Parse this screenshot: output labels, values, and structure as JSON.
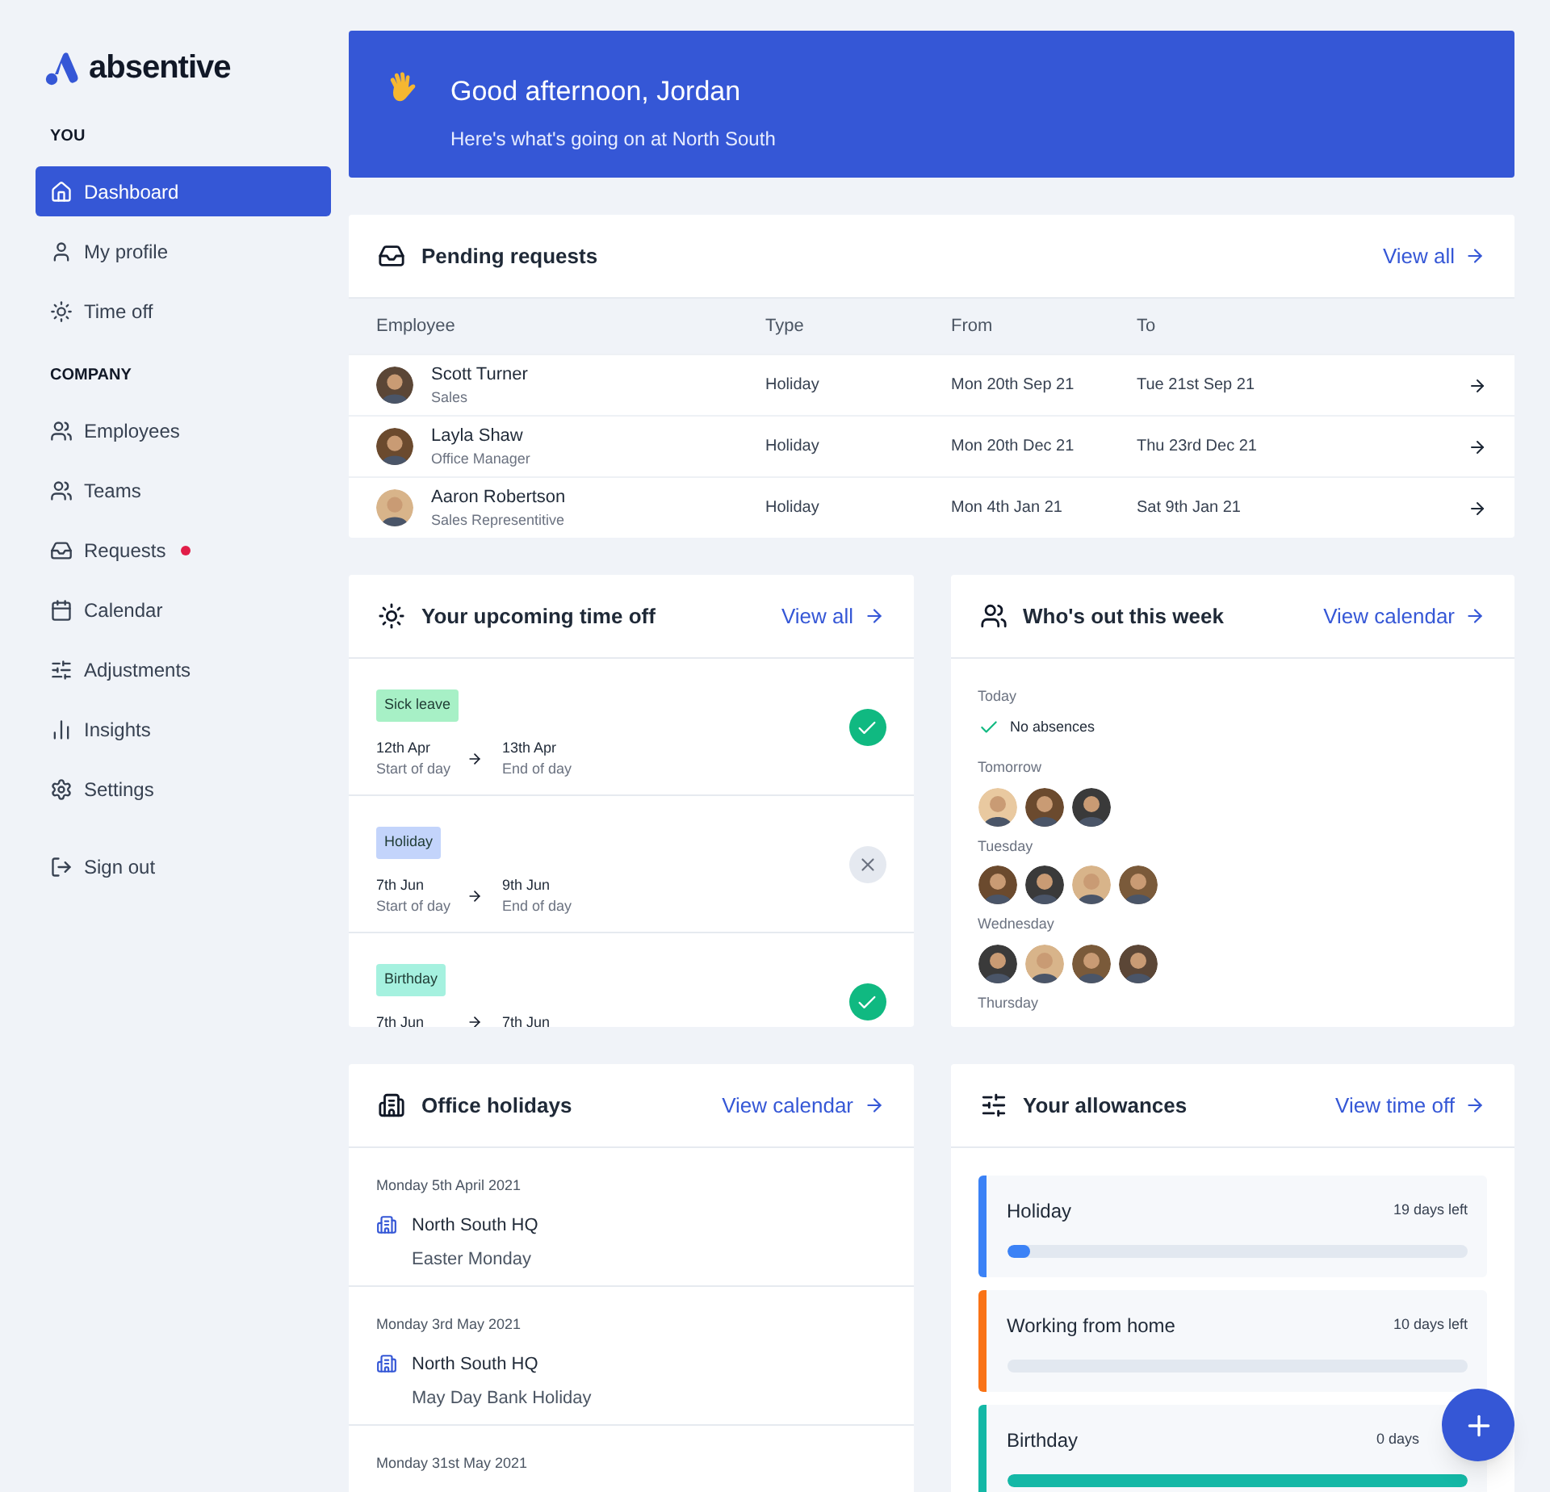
{
  "brand": {
    "name": "absentive"
  },
  "sidebar": {
    "sections": [
      {
        "title": "YOU",
        "items": [
          {
            "label": "Dashboard",
            "selected": true,
            "dot": false
          },
          {
            "label": "My profile",
            "selected": false,
            "dot": false
          },
          {
            "label": "Time off",
            "selected": false,
            "dot": false
          }
        ]
      },
      {
        "title": "COMPANY",
        "items": [
          {
            "label": "Employees",
            "selected": false,
            "dot": false
          },
          {
            "label": "Teams",
            "selected": false,
            "dot": false
          },
          {
            "label": "Requests",
            "selected": false,
            "dot": true
          },
          {
            "label": "Calendar",
            "selected": false,
            "dot": false
          },
          {
            "label": "Adjustments",
            "selected": false,
            "dot": false
          },
          {
            "label": "Insights",
            "selected": false,
            "dot": false
          },
          {
            "label": "Settings",
            "selected": false,
            "dot": false
          }
        ]
      }
    ],
    "sign_out": "Sign out"
  },
  "welcome": {
    "title": "Good afternoon, Jordan",
    "subtitle": "Here's what's going on at North South"
  },
  "pending_requests": {
    "title": "Pending requests",
    "link": "View all",
    "columns": [
      "Employee",
      "Type",
      "From",
      "To"
    ],
    "rows": [
      {
        "name": "Scott Turner",
        "role": "Sales",
        "type": "Holiday",
        "from": "Mon 20th Sep 21",
        "to": "Tue 21st Sep 21"
      },
      {
        "name": "Layla Shaw",
        "role": "Office Manager",
        "type": "Holiday",
        "from": "Mon 20th Dec 21",
        "to": "Thu 23rd Dec 21"
      },
      {
        "name": "Aaron Robertson",
        "role": "Sales Representitive",
        "type": "Holiday",
        "from": "Mon 4th Jan 21",
        "to": "Sat 9th Jan 21"
      }
    ]
  },
  "upcoming_time_off": {
    "title": "Your upcoming time off",
    "link": "View all",
    "items": [
      {
        "tag": "Sick leave",
        "color": "#a7f0c6",
        "approved": true,
        "start": "12th Apr",
        "start_note": "Start of day",
        "end": "13th Apr",
        "end_note": "End of day"
      },
      {
        "tag": "Holiday",
        "color": "#c3d4fb",
        "approved": false,
        "start": "7th Jun",
        "start_note": "Start of day",
        "end": "9th Jun",
        "end_note": "End of day"
      },
      {
        "tag": "Birthday",
        "color": "#a5f1df",
        "approved": true,
        "start": "7th Jun",
        "end": "7th Jun"
      }
    ]
  },
  "whos_out": {
    "title": "Who's out this week",
    "link": "View calendar",
    "days": [
      {
        "label": "Today",
        "none_text": "No absences"
      },
      {
        "label": "Tomorrow"
      },
      {
        "label": "Tuesday"
      },
      {
        "label": "Wednesday"
      },
      {
        "label": "Thursday"
      }
    ]
  },
  "office_holidays": {
    "title": "Office holidays",
    "link": "View calendar",
    "items": [
      {
        "date": "Monday 5th April 2021",
        "office": "North South HQ",
        "name": "Easter Monday"
      },
      {
        "date": "Monday 3rd May 2021",
        "office": "North South HQ",
        "name": "May Day Bank Holiday"
      },
      {
        "date": "Monday 31st May 2021"
      }
    ]
  },
  "allowances": {
    "title": "Your allowances",
    "link": "View time off",
    "items": [
      {
        "name": "Holiday",
        "left": "19 days left",
        "color": "#3b82f6",
        "level": 0.05
      },
      {
        "name": "Working from home",
        "left": "10 days left",
        "color": "#f97316",
        "level": 0
      },
      {
        "name": "Birthday",
        "left": "0 days",
        "color": "#14b8a6",
        "level": 1
      }
    ]
  }
}
